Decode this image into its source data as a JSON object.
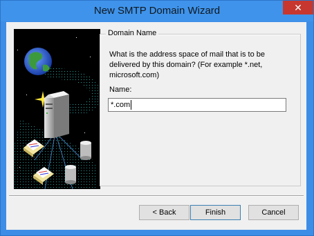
{
  "window": {
    "title": "New SMTP Domain Wizard",
    "close_glyph": "✕"
  },
  "colors": {
    "titlebar": "#3f93ea",
    "close": "#c7372f",
    "client": "#f0f0f0"
  },
  "group": {
    "legend": "Domain Name",
    "description": "What is the address space of mail that is to be delivered by this domain? (For example *.net, microsoft.com)",
    "name_label": "Name:",
    "name_value": "*.com"
  },
  "buttons": {
    "back": "< Back",
    "finish": "Finish",
    "cancel": "Cancel"
  },
  "illustration": {
    "icons": [
      "globe-icon",
      "server-icon",
      "envelope-icon",
      "cylinder-icon"
    ]
  }
}
